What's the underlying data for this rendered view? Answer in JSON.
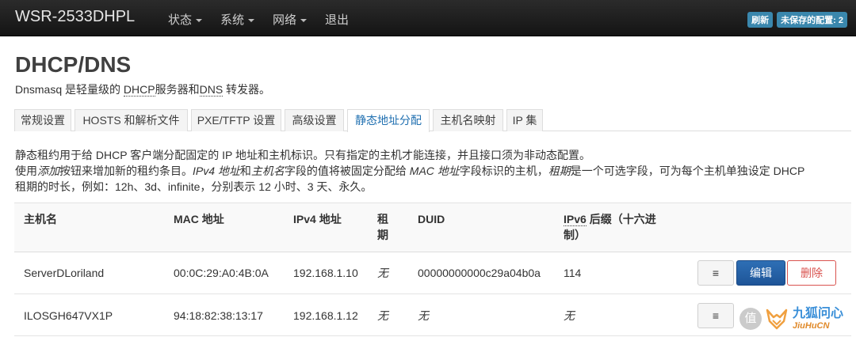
{
  "navbar": {
    "brand": "WSR-2533DHPL",
    "menu": [
      {
        "label": "状态",
        "dropdown": true
      },
      {
        "label": "系统",
        "dropdown": true
      },
      {
        "label": "网络",
        "dropdown": true
      },
      {
        "label": "退出",
        "dropdown": false
      }
    ],
    "refresh_badge": "刷新",
    "unsaved_badge": "未保存的配置: 2"
  },
  "page": {
    "title": "DHCP/DNS",
    "desc_prefix": "Dnsmasq 是轻量级的 ",
    "desc_dhcp": "DHCP",
    "desc_mid": "服务器和",
    "desc_dns": "DNS",
    "desc_suffix": " 转发器。"
  },
  "tabs": [
    "常规设置",
    "HOSTS 和解析文件",
    "PXE/TFTP 设置",
    "高级设置",
    "静态地址分配",
    "主机名映射",
    "IP 集"
  ],
  "active_tab": "静态地址分配",
  "intro": {
    "line1": "静态租约用于给 DHCP 客户端分配固定的 IP 地址和主机标识。只有指定的主机才能连接，并且接口须为非动态配置。",
    "line2_a": "使用",
    "line2_add": "添加",
    "line2_b": "按钮来增加新的租约条目。",
    "line2_ipv4": "IPv4 地址",
    "line2_c": "和",
    "line2_host": "主机名",
    "line2_d": "字段的值将被固定分配给 ",
    "line2_mac": "MAC 地址",
    "line2_e": "字段标识的主机，",
    "line2_lease": "租期",
    "line2_f": "是一个可选字段，可为每个主机单独设定 DHCP",
    "line3": "租期的时长，例如：12h、3d、infinite，分别表示 12 小时、3 天、永久。"
  },
  "table": {
    "headers": {
      "hostname": "主机名",
      "mac": "MAC 地址",
      "ipv4": "IPv4 地址",
      "lease_1": "租",
      "lease_2": "期",
      "duid": "DUID",
      "ipv6_1": "IPv6",
      "ipv6_2": " 后缀（十六进",
      "ipv6_3": "制）"
    },
    "rows": [
      {
        "hostname": "ServerDLoriland",
        "mac": "00:0C:29:A0:4B:0A",
        "ipv4": "192.168.1.10",
        "lease": "无",
        "duid": "00000000000c29a04b0a",
        "ipv6": "114"
      },
      {
        "hostname": "ILOSGH647VX1P",
        "mac": "94:18:82:38:13:17",
        "ipv4": "192.168.1.12",
        "lease": "无",
        "duid": "无",
        "ipv6": "无"
      }
    ],
    "menu_glyph": "≡",
    "edit_label": "编辑",
    "delete_label": "删除"
  },
  "watermark": {
    "badge": "值",
    "name_cn": "九狐问心",
    "name_en": "JiuHuCN"
  },
  "colors": {
    "navbar_bg": "#1c1c1c",
    "badge_bg": "#3a87ad",
    "active_tab": "#1f6fb0",
    "edit_button": "#2462a8",
    "delete_button": "#d9534f"
  }
}
